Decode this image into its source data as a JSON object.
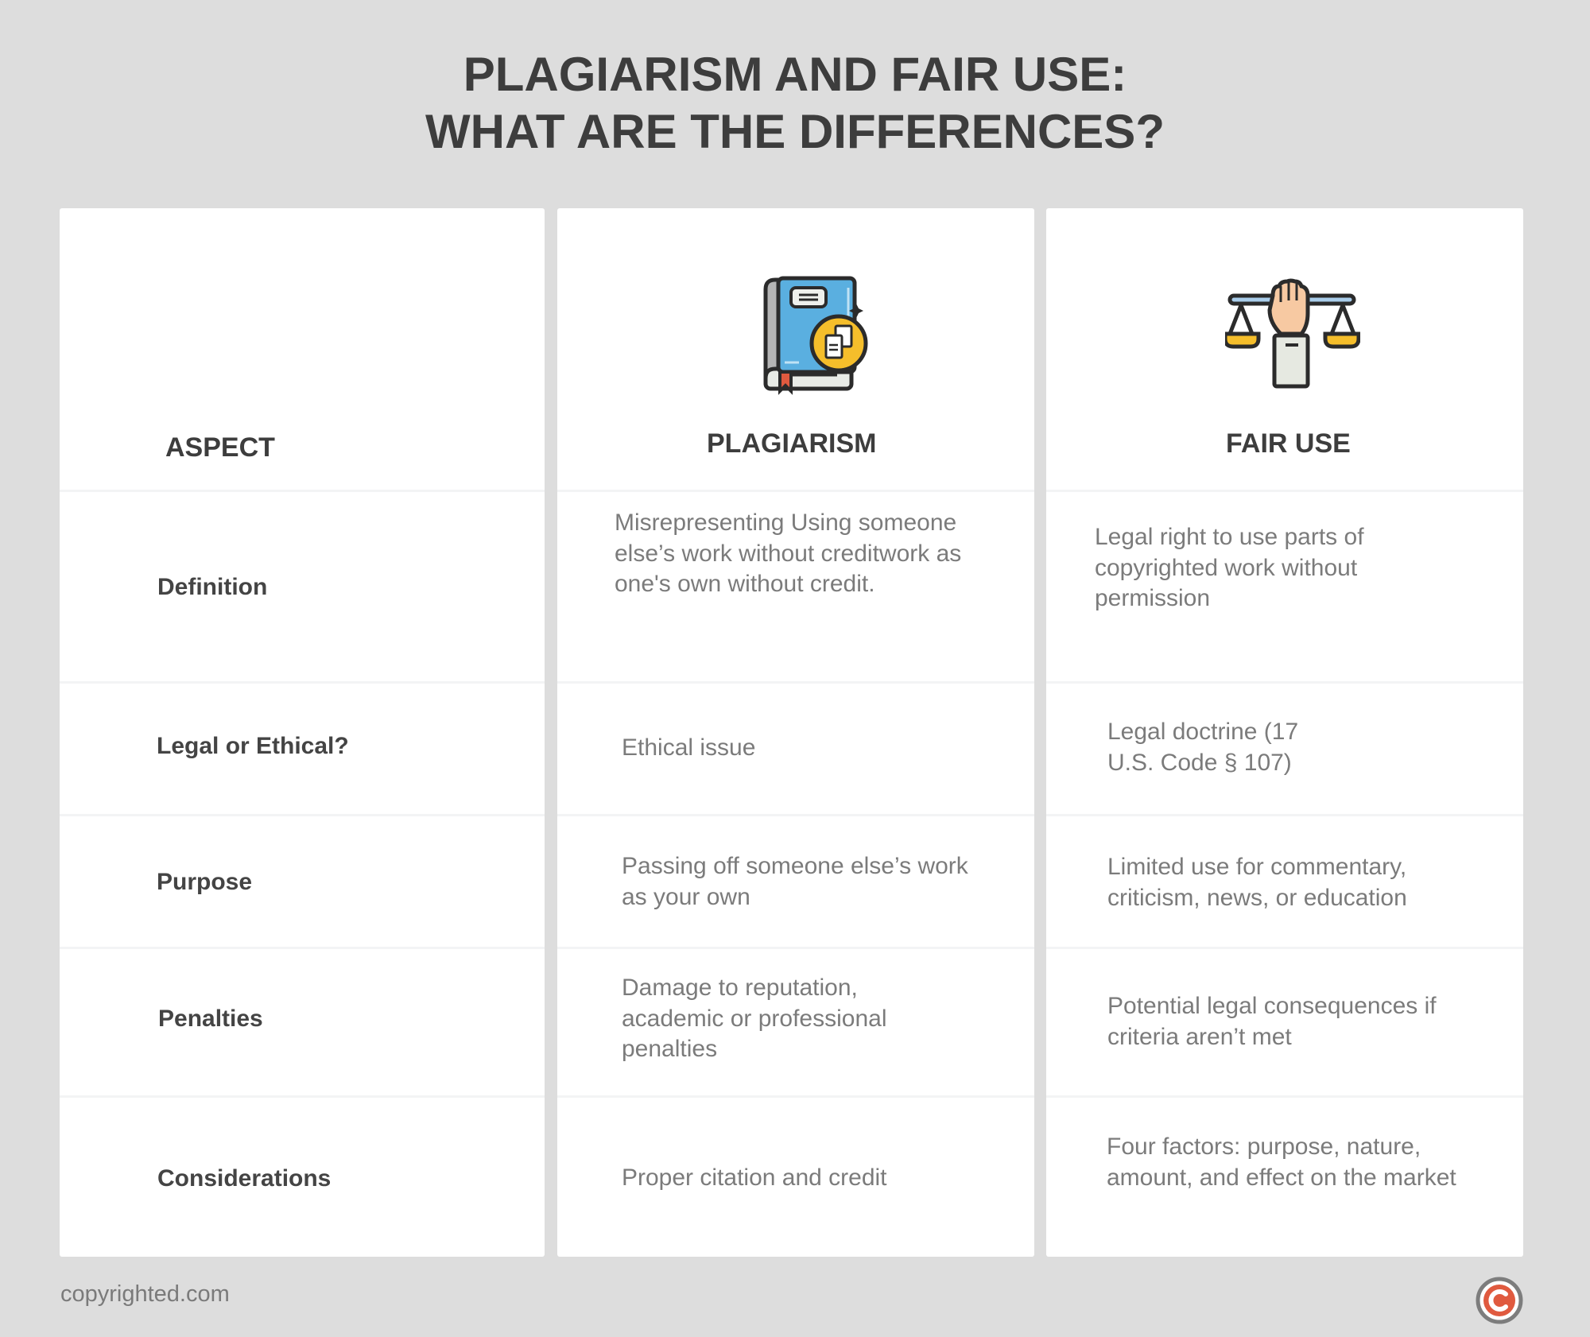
{
  "title": {
    "line1": "PLAGIARISM AND FAIR USE:",
    "line2": "WHAT ARE THE DIFFERENCES?"
  },
  "columns": {
    "aspect": {
      "header": "ASPECT"
    },
    "plagiarism": {
      "header": "PLAGIARISM",
      "icon": "book-copy-icon"
    },
    "fair_use": {
      "header": "FAIR USE",
      "icon": "hand-scale-icon"
    }
  },
  "rows": [
    {
      "aspect": "Definition",
      "plagiarism": "Misrepresenting Using someone else’s work without creditwork as one's own without credit.",
      "fair_use": "Legal right to use parts of copyrighted work without permission"
    },
    {
      "aspect": "Legal or Ethical?",
      "plagiarism": "Ethical issue",
      "fair_use": "Legal doctrine (17 U.S. Code § 107)"
    },
    {
      "aspect": "Purpose",
      "plagiarism": "Passing off someone else’s work as your own",
      "fair_use": "Limited use for commentary, criticism, news, or education"
    },
    {
      "aspect": "Penalties",
      "plagiarism": "Damage to reputation, academic or professional penalties",
      "fair_use": "Potential legal consequences if criteria aren’t met"
    },
    {
      "aspect": "Considerations",
      "plagiarism": "Proper citation and credit",
      "fair_use": "Four factors: purpose, nature, amount, and effect on the market"
    }
  ],
  "footer": {
    "site": "copyrighted.com",
    "logo_icon": "copyright-logo-icon"
  },
  "colors": {
    "background": "#dddddd",
    "card": "#ffffff",
    "title": "#3d3d3d",
    "body_text": "#7b7b7b",
    "logo_red": "#e05a3f",
    "logo_ring": "#7d7d7d",
    "book_blue": "#5aafe0",
    "badge_yellow": "#f5be2b",
    "skin": "#f7c9a2"
  }
}
